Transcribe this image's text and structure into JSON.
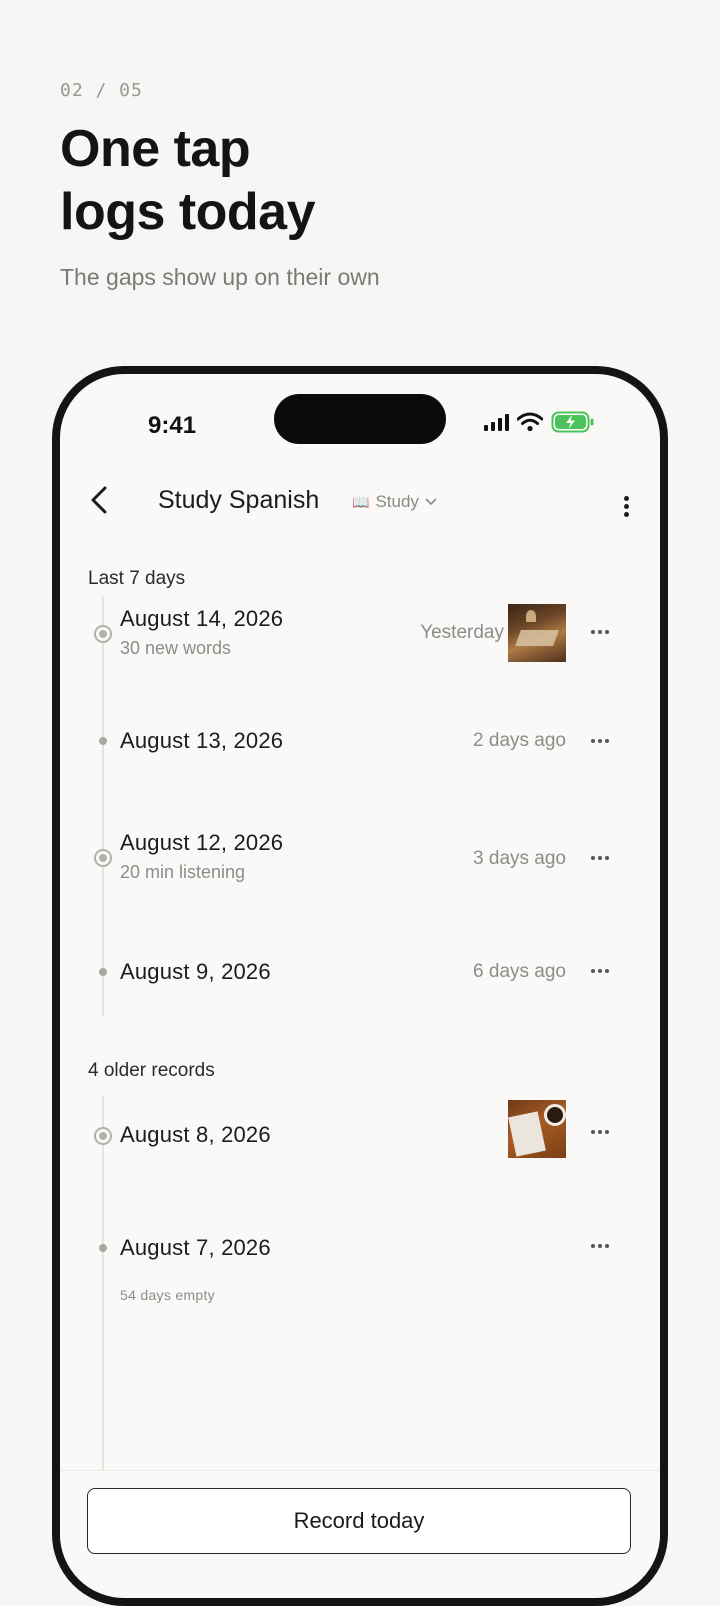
{
  "intro": {
    "step_indicator": "02 / 05",
    "headline_line1": "One tap",
    "headline_line2": "logs today",
    "subtitle": "The gaps show up on their own"
  },
  "status_bar": {
    "time": "9:41"
  },
  "header": {
    "title": "Study Spanish",
    "category_icon": "book-icon",
    "category_label": "Study"
  },
  "sections": {
    "recent_title": "Last 7 days",
    "older_title": "4 older records"
  },
  "entries": [
    {
      "date": "August 14, 2026",
      "note": "30 new words",
      "relative": "Yesterday",
      "has_photo": true
    },
    {
      "date": "August 13, 2026",
      "note": "",
      "relative": "2 days ago",
      "has_photo": false
    },
    {
      "date": "August 12, 2026",
      "note": "20 min listening",
      "relative": "3 days ago",
      "has_photo": false
    },
    {
      "date": "August 9, 2026",
      "note": "",
      "relative": "6 days ago",
      "has_photo": false
    },
    {
      "date": "August 8, 2026",
      "note": "",
      "relative": "",
      "has_photo": true
    },
    {
      "date": "August 7, 2026",
      "note": "",
      "relative": "",
      "has_photo": false
    }
  ],
  "empty_note": "54 days empty",
  "actions": {
    "record_label": "Record today"
  },
  "colors": {
    "background": "#f7f6f4",
    "battery_green": "#4cc35a",
    "text_primary": "#1c1c1c",
    "text_secondary": "#8d8c88"
  }
}
